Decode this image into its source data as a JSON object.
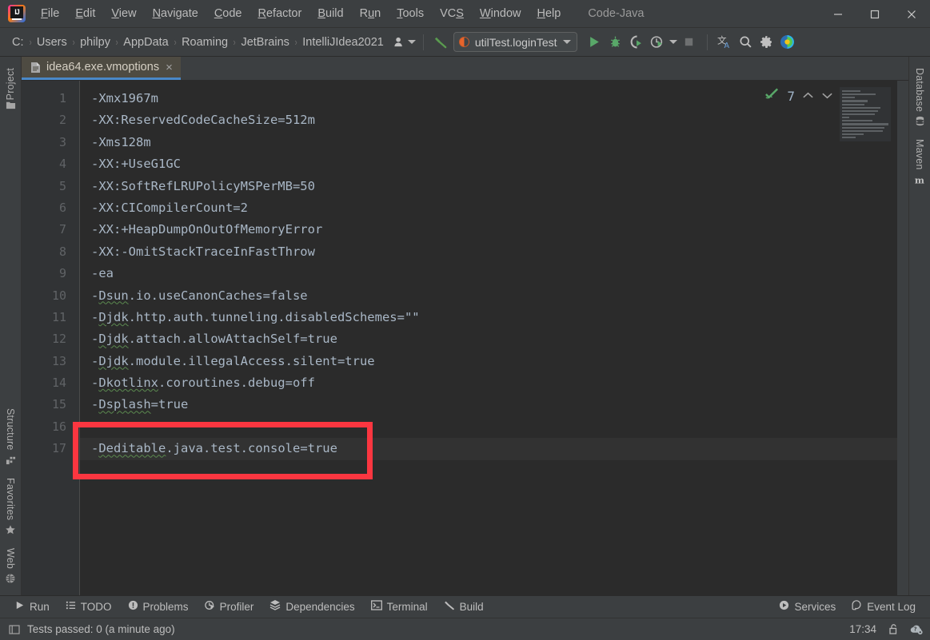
{
  "window": {
    "title": "Code-Java",
    "app_icon": "intellij-idea-logo",
    "minimize": "—",
    "maximize": "□",
    "close": "✕"
  },
  "menubar": {
    "items": [
      {
        "label": "File",
        "mnemonic": "F"
      },
      {
        "label": "Edit",
        "mnemonic": "E"
      },
      {
        "label": "View",
        "mnemonic": "V"
      },
      {
        "label": "Navigate",
        "mnemonic": "N"
      },
      {
        "label": "Code",
        "mnemonic": "C"
      },
      {
        "label": "Refactor",
        "mnemonic": "R"
      },
      {
        "label": "Build",
        "mnemonic": "B"
      },
      {
        "label": "Run",
        "mnemonic": "u"
      },
      {
        "label": "Tools",
        "mnemonic": "T"
      },
      {
        "label": "VCS",
        "mnemonic": "S"
      },
      {
        "label": "Window",
        "mnemonic": "W"
      },
      {
        "label": "Help",
        "mnemonic": "H"
      }
    ]
  },
  "navbar": {
    "breadcrumbs": [
      "C:",
      "Users",
      "philpy",
      "AppData",
      "Roaming",
      "JetBrains",
      "IntelliJIdea2021"
    ],
    "separator": "›",
    "person_icon": "person-dropdown-icon",
    "build_icon": "build-hammer-icon",
    "run_config": {
      "label": "utilTest.loginTest",
      "icon": "junit-config-icon",
      "dropdown": "chevron-down-icon"
    },
    "actions": [
      {
        "name": "run-button",
        "icon": "run-triangle-icon"
      },
      {
        "name": "debug-button",
        "icon": "debug-bug-icon"
      },
      {
        "name": "run-with-coverage-button",
        "icon": "coverage-icon"
      },
      {
        "name": "profile-button",
        "icon": "profiler-clock-icon"
      },
      {
        "name": "stop-button",
        "icon": "stop-square-icon"
      },
      {
        "name": "translate-button",
        "icon": "translate-icon"
      },
      {
        "name": "search-everywhere-button",
        "icon": "search-icon"
      },
      {
        "name": "settings-button",
        "icon": "gear-icon"
      },
      {
        "name": "ide-toolbar-extra-button",
        "icon": "color-circle-icon"
      }
    ]
  },
  "left_strip": {
    "top": [
      {
        "label": "Project",
        "icon": "folder-icon"
      }
    ],
    "bottom": [
      {
        "label": "Structure",
        "icon": "structure-icon"
      },
      {
        "label": "Favorites",
        "icon": "star-icon"
      },
      {
        "label": "Web",
        "icon": "globe-icon"
      }
    ]
  },
  "right_strip": {
    "top": [
      {
        "label": "Database",
        "icon": "database-icon"
      },
      {
        "label": "Maven",
        "icon": "maven-m-icon"
      }
    ]
  },
  "editor": {
    "tab": {
      "filename": "idea64.exe.vmoptions",
      "icon": "text-file-icon",
      "close": "×"
    },
    "current_line": 17,
    "analysis": {
      "count": "7",
      "icon": "inspection-ok-check-icon",
      "prev": "∧",
      "next": "∨"
    },
    "lines": [
      {
        "no": "1",
        "prefix": "-Xmx1967m",
        "token": "",
        "suffix": ""
      },
      {
        "no": "2",
        "prefix": "-XX:ReservedCodeCacheSize=512m",
        "token": "",
        "suffix": ""
      },
      {
        "no": "3",
        "prefix": "-Xms128m",
        "token": "",
        "suffix": ""
      },
      {
        "no": "4",
        "prefix": "-XX:+UseG1GC",
        "token": "",
        "suffix": ""
      },
      {
        "no": "5",
        "prefix": "-XX:SoftRefLRUPolicyMSPerMB=50",
        "token": "",
        "suffix": ""
      },
      {
        "no": "6",
        "prefix": "-XX:CICompilerCount=2",
        "token": "",
        "suffix": ""
      },
      {
        "no": "7",
        "prefix": "-XX:+HeapDumpOnOutOfMemoryError",
        "token": "",
        "suffix": ""
      },
      {
        "no": "8",
        "prefix": "-XX:-OmitStackTraceInFastThrow",
        "token": "",
        "suffix": ""
      },
      {
        "no": "9",
        "prefix": "-ea",
        "token": "",
        "suffix": ""
      },
      {
        "no": "10",
        "prefix": "-",
        "token": "Dsun",
        "suffix": ".io.useCanonCaches=false"
      },
      {
        "no": "11",
        "prefix": "-",
        "token": "Djdk",
        "suffix": ".http.auth.tunneling.disabledSchemes=\"\""
      },
      {
        "no": "12",
        "prefix": "-",
        "token": "Djdk",
        "suffix": ".attach.allowAttachSelf=true"
      },
      {
        "no": "13",
        "prefix": "-",
        "token": "Djdk",
        "suffix": ".module.illegalAccess.silent=true"
      },
      {
        "no": "14",
        "prefix": "-",
        "token": "Dkotlinx",
        "suffix": ".coroutines.debug=off"
      },
      {
        "no": "15",
        "prefix": "-",
        "token": "Dsplash",
        "suffix": "=true"
      },
      {
        "no": "16",
        "prefix": "",
        "token": "",
        "suffix": ""
      },
      {
        "no": "17",
        "prefix": "-",
        "token": "Deditable",
        "suffix": ".java.test.console=true"
      }
    ],
    "minimap_widths": [
      40,
      72,
      28,
      55,
      48,
      82,
      78,
      70,
      16,
      66,
      100,
      92,
      88,
      46,
      30,
      8,
      96
    ]
  },
  "annotation": {
    "shape": "rectangle",
    "color": "#fb3640",
    "target_line": "17"
  },
  "tool_windows": {
    "left_items": [
      {
        "label": "Run",
        "icon": "run-triangle-icon"
      },
      {
        "label": "TODO",
        "icon": "todo-list-icon"
      },
      {
        "label": "Problems",
        "icon": "problems-exclamation-icon"
      },
      {
        "label": "Profiler",
        "icon": "profiler-icon"
      },
      {
        "label": "Dependencies",
        "icon": "dependencies-stack-icon"
      },
      {
        "label": "Terminal",
        "icon": "terminal-icon"
      },
      {
        "label": "Build",
        "icon": "build-hammer-icon"
      }
    ],
    "right_items": [
      {
        "label": "Services",
        "icon": "services-icon"
      },
      {
        "label": "Event Log",
        "icon": "event-log-icon"
      }
    ]
  },
  "statusbar": {
    "message": "Tests passed: 0 (a minute ago)",
    "message_icon": "tests-window-icon",
    "time": "17:34",
    "lock_icon": "unlocked-padlock-icon",
    "help_icon": "help-cloud-icon"
  }
}
